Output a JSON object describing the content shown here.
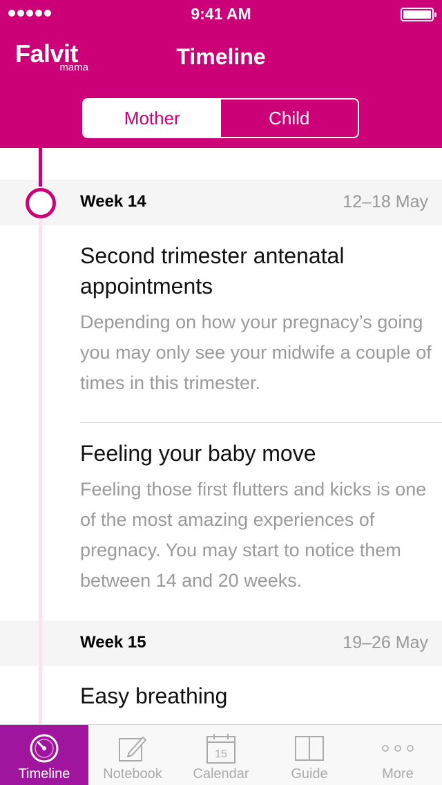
{
  "status_bar": {
    "time": "9:41 AM"
  },
  "header": {
    "logo_main": "Falvit",
    "logo_sub": "mama",
    "title": "Timeline",
    "segments": [
      {
        "label": "Mother",
        "selected": true
      },
      {
        "label": "Child",
        "selected": false
      }
    ]
  },
  "weeks": [
    {
      "title": "Week 14",
      "dates": "12–18 May",
      "articles": [
        {
          "title": "Second trimester antenatal appointments",
          "body": "Depending on how your pregnacy’s going you may only see your midwife a couple of times in this trimester."
        },
        {
          "title": "Feeling your baby move",
          "body": "Feeling those first flutters and kicks is one of the most amazing experiences of pregnacy. You may start to notice them between 14 and 20 weeks."
        }
      ]
    },
    {
      "title": "Week 15",
      "dates": "19–26 May",
      "articles": [
        {
          "title": "Easy breathing"
        }
      ]
    }
  ],
  "tabbar": {
    "tabs": [
      {
        "label": "Timeline",
        "icon": "timeline-clock-icon",
        "active": true
      },
      {
        "label": "Notebook",
        "icon": "notebook-pencil-icon",
        "active": false
      },
      {
        "label": "Calendar",
        "icon": "calendar-icon",
        "active": false,
        "icon_text": "15"
      },
      {
        "label": "Guide",
        "icon": "book-icon",
        "active": false
      },
      {
        "label": "More",
        "icon": "more-dots-icon",
        "active": false
      }
    ]
  },
  "colors": {
    "brand": "#cc0077",
    "tab_active": "#a0159d",
    "timeline_light": "#fbe2ef"
  }
}
